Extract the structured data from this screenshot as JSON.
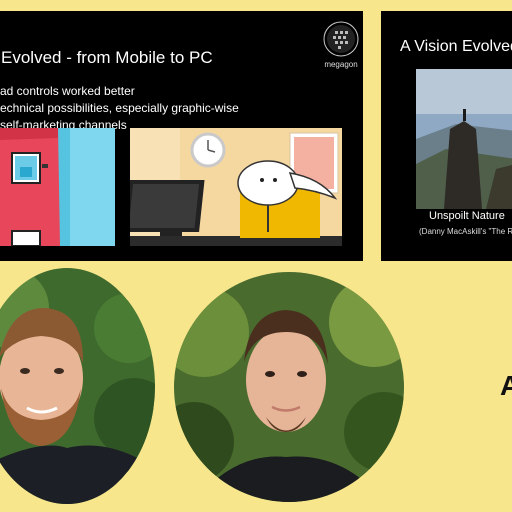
{
  "left_slide": {
    "title": "Evolved  - from Mobile to PC",
    "bullets": [
      "ad controls worked better",
      "echnical possibilities, especially graphic-wise",
      "self-marketing channels"
    ],
    "logo_text": "megagon"
  },
  "right_slide": {
    "title": "A Vision Evolved",
    "caption": "Unspoilt Nature",
    "caption_sub": "(Danny MacAskill's \"The R"
  },
  "side_letter": "A",
  "colors": {
    "background": "#f7e68c",
    "slide_bg": "#000000"
  }
}
